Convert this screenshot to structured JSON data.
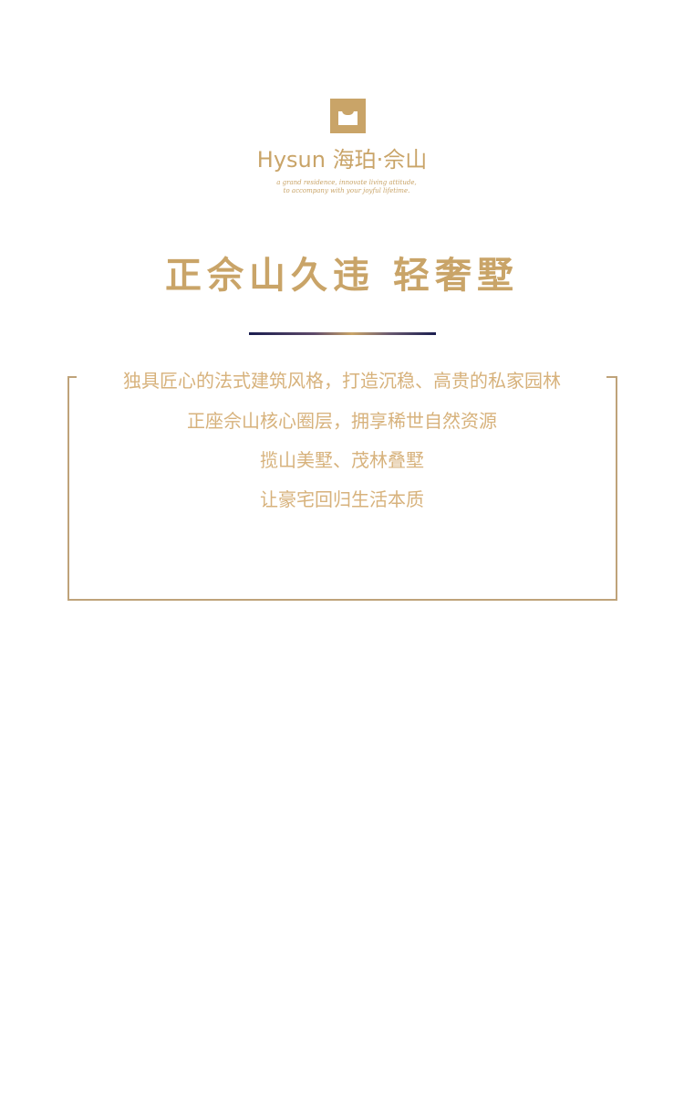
{
  "brand": {
    "name": "Hysun 海珀·佘山",
    "tagline_line1": "a grand residence, innovate living attitude,",
    "tagline_line2": "to accompany with your joyful lifetime."
  },
  "headline": "正佘山久违 轻奢墅",
  "body_lines": [
    "独具匠心的法式建筑风格，打造沉稳、高贵的私家园林",
    "正座佘山核心圈层，拥享稀世自然资源",
    "揽山美墅、茂林叠墅",
    "让豪宅回归生活本质"
  ],
  "colors": {
    "gold": "#c9a468",
    "text_gold": "#d7b27c",
    "frame": "#bfa37a",
    "navy": "#1a1d4f",
    "background": "#ffffff"
  },
  "icons": {
    "logo": "window-emblem-icon"
  }
}
